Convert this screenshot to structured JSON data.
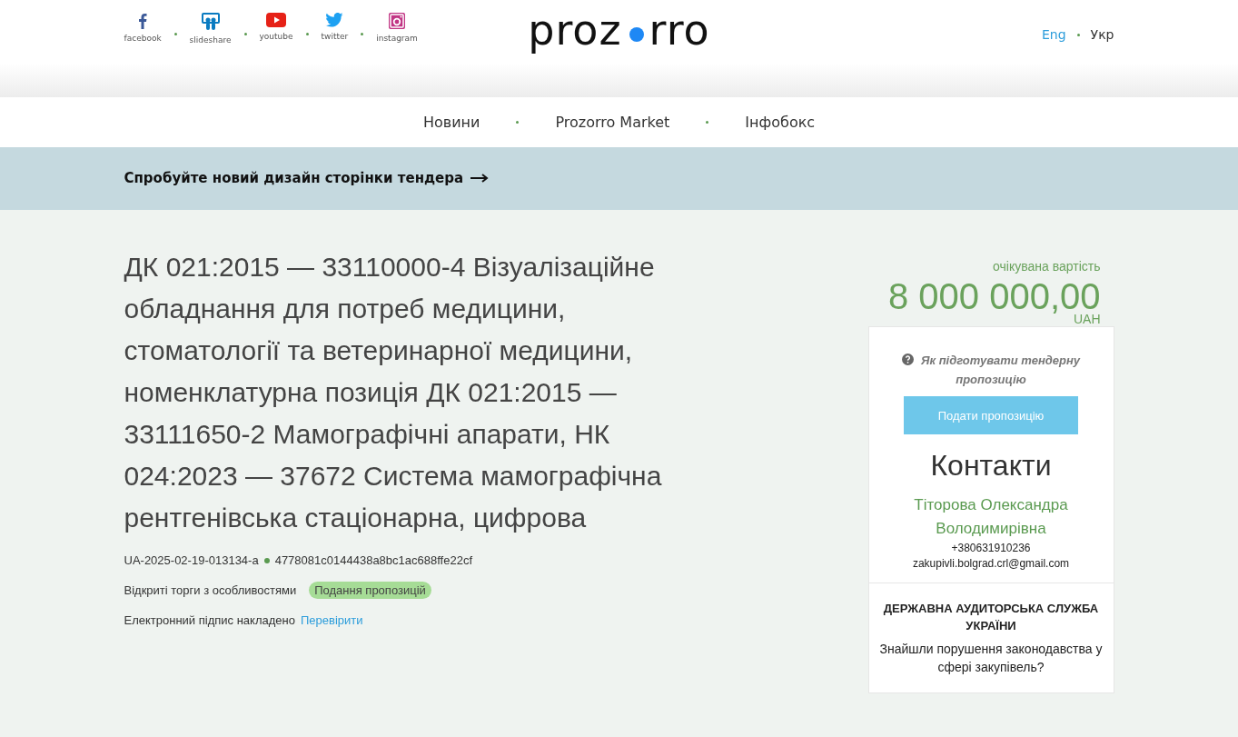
{
  "social": [
    {
      "kind": "facebook",
      "label": "facebook"
    },
    {
      "kind": "slideshare",
      "label": "slideshare"
    },
    {
      "kind": "youtube",
      "label": "youtube"
    },
    {
      "kind": "twitter",
      "label": "twitter"
    },
    {
      "kind": "instagram",
      "label": "instagram"
    }
  ],
  "logo": {
    "left": "proz",
    "right": "rro"
  },
  "languages": [
    {
      "label": "Eng",
      "selected": false
    },
    {
      "label": "Укр",
      "selected": true
    }
  ],
  "nav": [
    "Новини",
    "Prozorro Market",
    "Інфобокс"
  ],
  "banner": {
    "text": "Спробуйте новий дизайн сторінки тендера"
  },
  "tender": {
    "title": "ДК 021:2015 — 33110000-4 Візуалізаційне обладнання для потреб медицини, стоматології та ветеринарної медицини, номенклатурна позиція ДК 021:2015 — 33111650-2 Мамографічні апарати, НК 024:2023 — 37672 Система мамографічна рентгенівська стаціонарна, цифрова",
    "id": "UA-2025-02-19-013134-a",
    "hash": "4778081c0144438a8bc1ac688ffe22cf",
    "procedure": "Відкриті торги з особливостями",
    "status": "Подання пропозицій",
    "signature": "Електронний підпис накладено",
    "verify_link": "Перевірити"
  },
  "price": {
    "label": "очікувана вартість",
    "amount": "8 000 000,00",
    "currency": "UAH"
  },
  "sidebar": {
    "help_link": "Як підготувати тендерну пропозицію",
    "submit_button": "Подати пропозицію",
    "contacts_title": "Контакти",
    "contact_name": "Тіторова Олександра Володимирівна",
    "phone": "+380631910236",
    "email": "zakupivli.bolgrad.crl@gmail.com",
    "audit_title": "ДЕРЖАВНА АУДИТОРСЬКА СЛУЖБА УКРАЇНИ",
    "audit_text": "Знайшли порушення законодавства у сфері закупівель?"
  }
}
